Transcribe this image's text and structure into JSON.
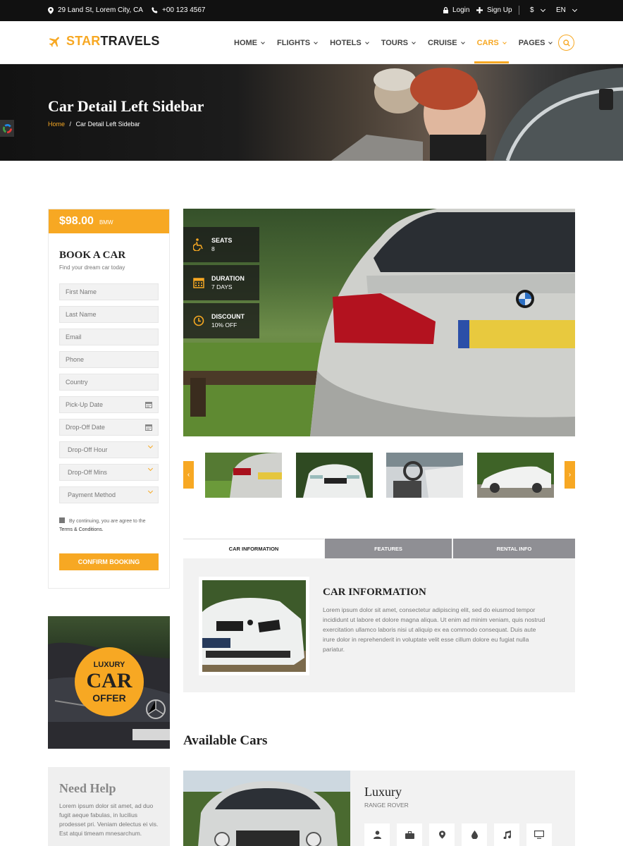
{
  "topbar": {
    "address": "29 Land St, Lorem City, CA",
    "phone": "+00 123 4567",
    "login": "Login",
    "signup": "Sign Up",
    "currency": "$",
    "language": "EN"
  },
  "logo": {
    "part1": "STAR",
    "part2": "TRAVELS"
  },
  "nav": {
    "items": [
      {
        "label": "HOME"
      },
      {
        "label": "FLIGHTS"
      },
      {
        "label": "HOTELS"
      },
      {
        "label": "TOURS"
      },
      {
        "label": "CRUISE"
      },
      {
        "label": "CARS"
      },
      {
        "label": "PAGES"
      }
    ],
    "active": "CARS"
  },
  "hero": {
    "title": "Car Detail Left Sidebar",
    "breadcrumb_home": "Home",
    "breadcrumb_sep": "/",
    "breadcrumb_current": "Car Detail Left Sidebar"
  },
  "booking": {
    "price": "$98.00",
    "brand": "BMW",
    "title": "BOOK A CAR",
    "subtitle": "Find your dream car today",
    "fields": {
      "first_name": "First Name",
      "last_name": "Last Name",
      "email": "Email",
      "phone": "Phone",
      "country": "Country",
      "pickup_date": "Pick-Up Date",
      "dropoff_date": "Drop-Off Date",
      "dropoff_hour": "Drop-Off Hour",
      "dropoff_mins": "Drop-Off Mins",
      "payment_method": "Payment Method"
    },
    "agree_text": "By continuing, you are agree to the",
    "terms_link": "Terms & Conditions.",
    "confirm": "CONFIRM BOOKING"
  },
  "offer": {
    "line1": "LUXURY",
    "line2": "CAR",
    "line3": "OFFER"
  },
  "help": {
    "title": "Need Help",
    "text": "Lorem ipsum dolor sit amet, ad duo fugit aeque fabulas, in lucilius prodesset pri. Veniam delectus ei vis. Est atqui timeam mnesarchum."
  },
  "stats": [
    {
      "label": "SEATS",
      "value": "8",
      "icon": "wheelchair-icon"
    },
    {
      "label": "DURATION",
      "value": "7 DAYS",
      "icon": "calendar-icon"
    },
    {
      "label": "DISCOUNT",
      "value": "10% OFF",
      "icon": "clock-icon"
    }
  ],
  "tabs": {
    "items": [
      "CAR INFORMATION",
      "FEATURES",
      "RENTAL INFO"
    ],
    "title": "CAR INFORMATION",
    "text": "Lorem ipsum dolor sit amet, consectetur adipiscing elit, sed do eiusmod tempor incididunt ut labore et dolore magna aliqua. Ut enim ad minim veniam, quis nostrud exercitation ullamco laboris nisi ut aliquip ex ea commodo consequat. Duis aute irure dolor in reprehenderit in voluptate velit esse cillum dolore eu fugiat nulla pariatur."
  },
  "available": {
    "title": "Available Cars",
    "car_name": "Luxury",
    "car_sub": "RANGE ROVER",
    "features": [
      "user-icon",
      "briefcase-icon",
      "map-pin-icon",
      "drop-icon",
      "music-icon",
      "monitor-icon"
    ]
  },
  "colors": {
    "accent": "#f7a823",
    "dark": "#111111"
  }
}
